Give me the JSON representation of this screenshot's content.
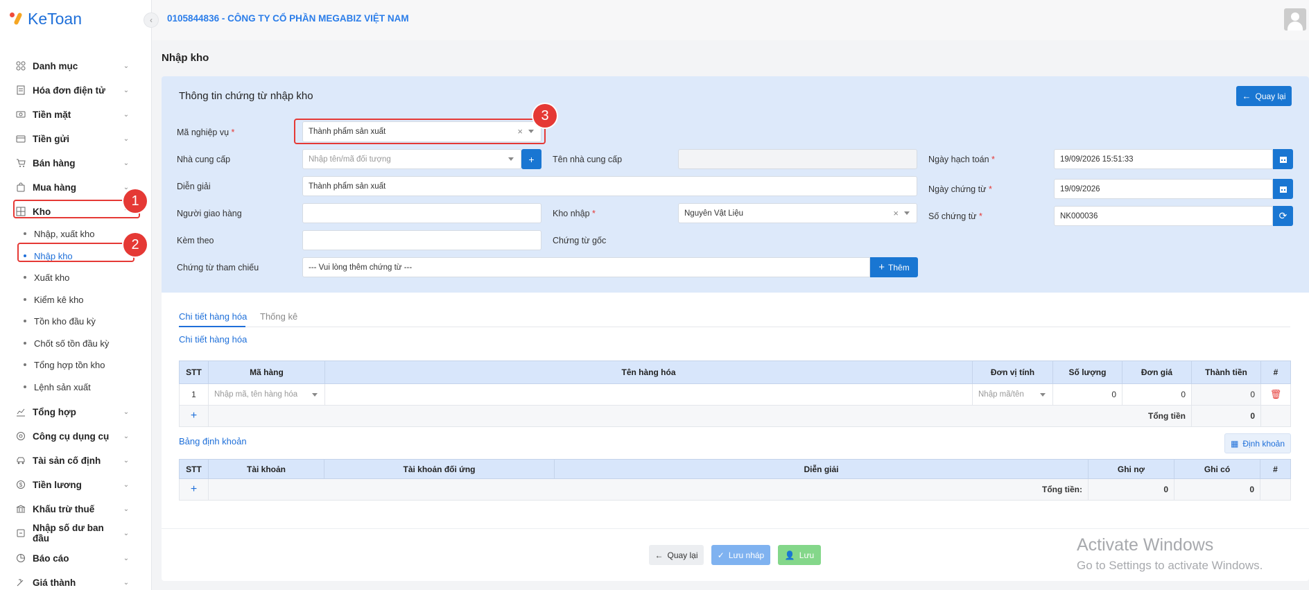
{
  "app": {
    "logo_text": "KeToan"
  },
  "header": {
    "company": "0105844836 - CÔNG TY CỔ PHẦN MEGABIZ VIỆT NAM"
  },
  "sidebar": {
    "items": [
      {
        "label": "Danh mục",
        "icon": "grid-icon"
      },
      {
        "label": "Hóa đơn điện tử",
        "icon": "invoice-icon"
      },
      {
        "label": "Tiền mặt",
        "icon": "cash-icon"
      },
      {
        "label": "Tiền gửi",
        "icon": "bank-icon"
      },
      {
        "label": "Bán hàng",
        "icon": "cart-icon"
      },
      {
        "label": "Mua hàng",
        "icon": "bag-icon"
      },
      {
        "label": "Kho",
        "icon": "warehouse-icon"
      }
    ],
    "kho_sub": [
      {
        "label": "Nhập, xuất kho"
      },
      {
        "label": "Nhập kho"
      },
      {
        "label": "Xuất kho"
      },
      {
        "label": "Kiểm kê kho"
      },
      {
        "label": "Tồn kho đầu kỳ"
      },
      {
        "label": "Chốt số tồn đầu kỳ"
      },
      {
        "label": "Tổng hợp tồn kho"
      },
      {
        "label": "Lệnh sản xuất"
      }
    ],
    "items_after": [
      {
        "label": "Tổng hợp",
        "icon": "chart-icon"
      },
      {
        "label": "Công cụ dụng cụ",
        "icon": "tools-icon"
      },
      {
        "label": "Tài sản cố định",
        "icon": "car-icon"
      },
      {
        "label": "Tiền lương",
        "icon": "salary-icon"
      },
      {
        "label": "Khấu trừ thuế",
        "icon": "tax-icon"
      },
      {
        "label": "Nhập số dư ban đầu",
        "icon": "balance-icon"
      },
      {
        "label": "Báo cáo",
        "icon": "report-icon"
      },
      {
        "label": "Giá thành",
        "icon": "price-icon"
      }
    ]
  },
  "annotations": {
    "n1": "1",
    "n2": "2",
    "n3": "3"
  },
  "page": {
    "title": "Nhập kho"
  },
  "form": {
    "title": "Thông tin chứng từ nhập kho",
    "back_label": "Quay lại",
    "ma_nghiep_vu": {
      "label": "Mã nghiệp vụ",
      "value": "Thành phẩm sản xuất"
    },
    "nha_cung_cap": {
      "label": "Nhà cung cấp",
      "placeholder": "Nhập tên/mã đối tượng"
    },
    "ten_nha_cung_cap": {
      "label": "Tên nhà cung cấp",
      "value": ""
    },
    "ngay_hach_toan": {
      "label": "Ngày hạch toán",
      "value": "19/09/2026 15:51:33"
    },
    "dien_giai": {
      "label": "Diễn giải",
      "value": "Thành phẩm sản xuất"
    },
    "ngay_chung_tu": {
      "label": "Ngày chứng từ",
      "value": "19/09/2026"
    },
    "nguoi_giao_hang": {
      "label": "Người giao hàng",
      "value": ""
    },
    "kho_nhap": {
      "label": "Kho nhập",
      "value": "Nguyên Vật Liệu"
    },
    "so_chung_tu": {
      "label": "Số chứng từ",
      "value": "NK000036"
    },
    "kem_theo": {
      "label": "Kèm theo",
      "value": ""
    },
    "chung_tu_goc": {
      "label": "Chứng từ gốc"
    },
    "chung_tu_tham_chieu": {
      "label": "Chứng từ tham chiếu",
      "placeholder": "--- Vui lòng thêm chứng từ ---",
      "add_label": "Thêm"
    }
  },
  "tabs": [
    {
      "label": "Chi tiết hàng hóa"
    },
    {
      "label": "Thống kê"
    }
  ],
  "goods": {
    "section_title": "Chi tiết hàng hóa",
    "columns": [
      "STT",
      "Mã hàng",
      "Tên hàng hóa",
      "Đơn vị tính",
      "Số lượng",
      "Đơn giá",
      "Thành tiền",
      "#"
    ],
    "rows": [
      {
        "stt": "1",
        "ma_hang_ph": "Nhập mã, tên hàng hóa",
        "ten_hang": "",
        "dvt_ph": "Nhập mã/tên",
        "so_luong": "0",
        "don_gia": "0",
        "thanh_tien": "0"
      }
    ],
    "total_label": "Tổng tiền",
    "total_value": "0"
  },
  "accounting": {
    "section_title": "Bảng định khoản",
    "button_label": "Định khoản",
    "columns": [
      "STT",
      "Tài khoản",
      "Tài khoản đối ứng",
      "Diễn giải",
      "Ghi nợ",
      "Ghi có",
      "#"
    ],
    "total_label": "Tổng tiền:",
    "total_debit": "0",
    "total_credit": "0"
  },
  "footer": {
    "back_label": "Quay lại",
    "draft_label": "Lưu nháp",
    "save_label": "Lưu"
  },
  "watermark": {
    "line1": "Activate Windows",
    "line2": "Go to Settings to activate Windows."
  },
  "colors": {
    "primary": "#1976d2",
    "annotation": "#e53935",
    "form_bg": "#dde9fa"
  }
}
